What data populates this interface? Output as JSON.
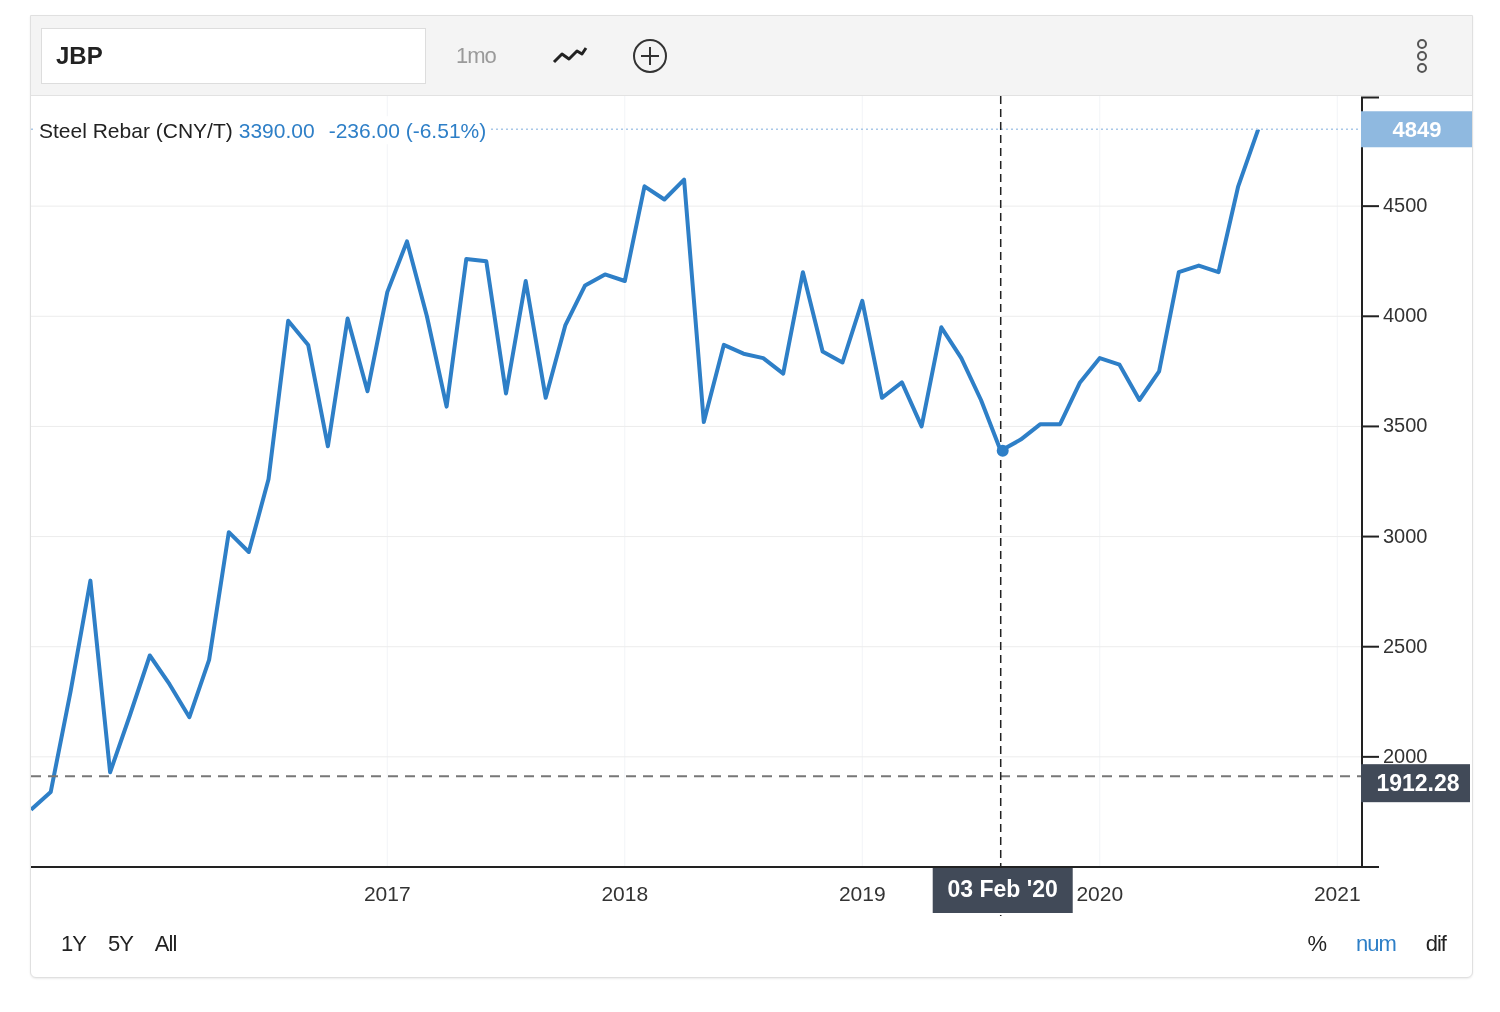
{
  "toolbar": {
    "symbol_field": {
      "value": "JBP"
    },
    "interval_button": "1mo"
  },
  "chart": {
    "legend": {
      "name": "Steel Rebar (CNY/T)",
      "price": "3390.00",
      "change": "-236.00 (-6.51%)"
    },
    "chart_data": {
      "type": "line",
      "x": [
        2015.5,
        2015.583,
        2015.667,
        2015.75,
        2015.833,
        2015.917,
        2016,
        2016.083,
        2016.167,
        2016.25,
        2016.333,
        2016.417,
        2016.5,
        2016.583,
        2016.667,
        2016.75,
        2016.833,
        2016.917,
        2017,
        2017.083,
        2017.167,
        2017.25,
        2017.333,
        2017.417,
        2017.5,
        2017.583,
        2017.667,
        2017.75,
        2017.833,
        2017.917,
        2018,
        2018.083,
        2018.167,
        2018.25,
        2018.333,
        2018.417,
        2018.5,
        2018.583,
        2018.667,
        2018.75,
        2018.833,
        2018.917,
        2019,
        2019.083,
        2019.167,
        2019.25,
        2019.333,
        2019.417,
        2019.5,
        2019.583,
        2019.667,
        2019.75,
        2019.833,
        2019.917,
        2020,
        2020.083,
        2020.167,
        2020.25,
        2020.333,
        2020.417,
        2020.5,
        2020.583,
        2020.667
      ],
      "series": [
        {
          "color": "#2e7fc7",
          "values": [
            1760,
            1840,
            2300,
            2800,
            1930,
            2190,
            2460,
            2330,
            2180,
            2440,
            3020,
            2930,
            3260,
            3980,
            3870,
            3410,
            3990,
            3660,
            4110,
            4340,
            4000,
            3590,
            4260,
            4250,
            3650,
            4160,
            3630,
            3960,
            4140,
            4190,
            4160,
            4590,
            4530,
            4620,
            3520,
            3870,
            3830,
            3810,
            3740,
            4200,
            3840,
            3790,
            4070,
            3630,
            3700,
            3500,
            3950,
            3810,
            3620,
            3390,
            3440,
            3510,
            3510,
            3700,
            3810,
            3780,
            3620,
            3750,
            4200,
            4230,
            4200,
            4590,
            4849
          ]
        }
      ],
      "xlim": [
        2015.5,
        2021.1
      ],
      "ylim": [
        1500,
        5000
      ],
      "xticks": [
        2017,
        2018,
        2019,
        2020,
        2021
      ],
      "yticks": [
        2000,
        2500,
        3000,
        3500,
        4000,
        4500
      ],
      "grid": true,
      "ref_lines": [
        {
          "axis": "y",
          "value": 4849,
          "label": "4849",
          "color": "#a9c8e8"
        },
        {
          "axis": "y",
          "value": 1912.28,
          "label": "1912.28",
          "color": "#777777"
        },
        {
          "axis": "x",
          "value": 2019.583,
          "label": "03 Feb '20",
          "color": "#222222"
        }
      ]
    }
  },
  "ranges": [
    {
      "label": "1Y",
      "selected": false
    },
    {
      "label": "5Y",
      "selected": false
    },
    {
      "label": "All",
      "selected": false
    }
  ],
  "modes": [
    {
      "label": "%",
      "selected": false
    },
    {
      "label": "num",
      "selected": true
    },
    {
      "label": "dif",
      "selected": false
    }
  ]
}
